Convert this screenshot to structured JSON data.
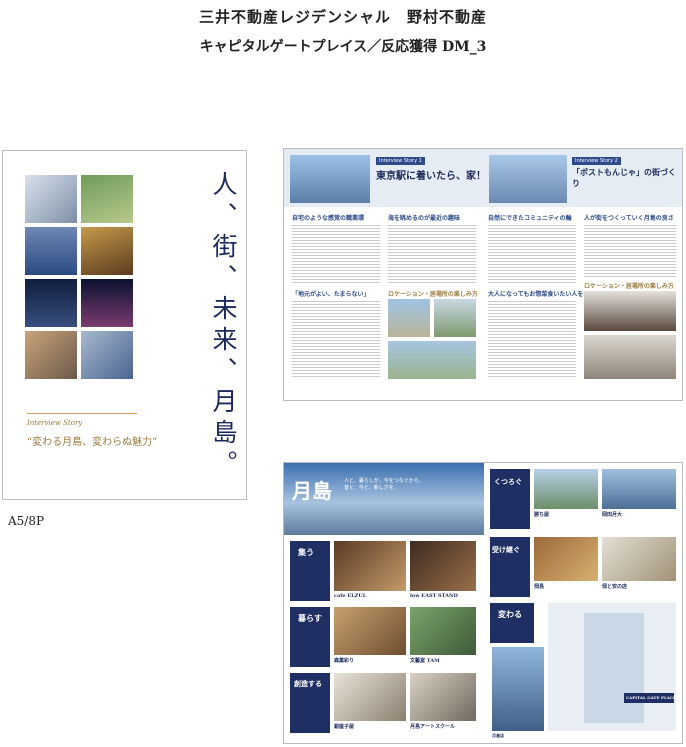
{
  "header": {
    "title": "三井不動産レジデンシャル　野村不動産",
    "subtitle": "キャピタルゲートプレイス／反応獲得 DM_3"
  },
  "format_label": "A5/8P",
  "cover": {
    "vertical_title": "人、街、未来、月島。",
    "story_label": "Interview Story",
    "tagline": "“変わる月島、変わらぬ魅力”"
  },
  "spread1": {
    "left_tag": "Interview Story 1",
    "left_head": "東京駅に着いたら、家！",
    "right_tag": "Interview Story 2",
    "right_head": "「ポストもんじゃ」の街づくり",
    "section_a": "自宅のような感覚の職業環",
    "section_b": "「地元がよい、たまらない」",
    "section_c": "海を眺めるのが最近の趣味",
    "section_d": "自然にできたコミュニティの輪",
    "section_e": "人も会えたくなる街を作りたいだ",
    "section_f": "人が街をつくっていく月島の良さ",
    "section_g": "大人になってもお惣菜食いたい人を",
    "caption_a": "ロケーション・居場所の楽しみ方",
    "caption_b": "ロケーション・居場所の楽しみ方"
  },
  "spread2": {
    "title": "月島",
    "lead": "人と、暮らしが、今をつなぐから。昔と、今と、新しさを。",
    "labels": [
      "集う",
      "暮らす",
      "創造する",
      "くつろぐ",
      "受け継ぐ",
      "変わる"
    ],
    "captions": [
      "cafe ELZUL",
      "low EAST STAND",
      "森菓彩り",
      "文藝室 TAM",
      "銀座子屋",
      "月島アートスクール",
      "勝ち屋",
      "岡田月大",
      "佃島",
      "佃と安の店",
      "月島店"
    ],
    "place_name": "CAPITAL GATE PLACE"
  }
}
